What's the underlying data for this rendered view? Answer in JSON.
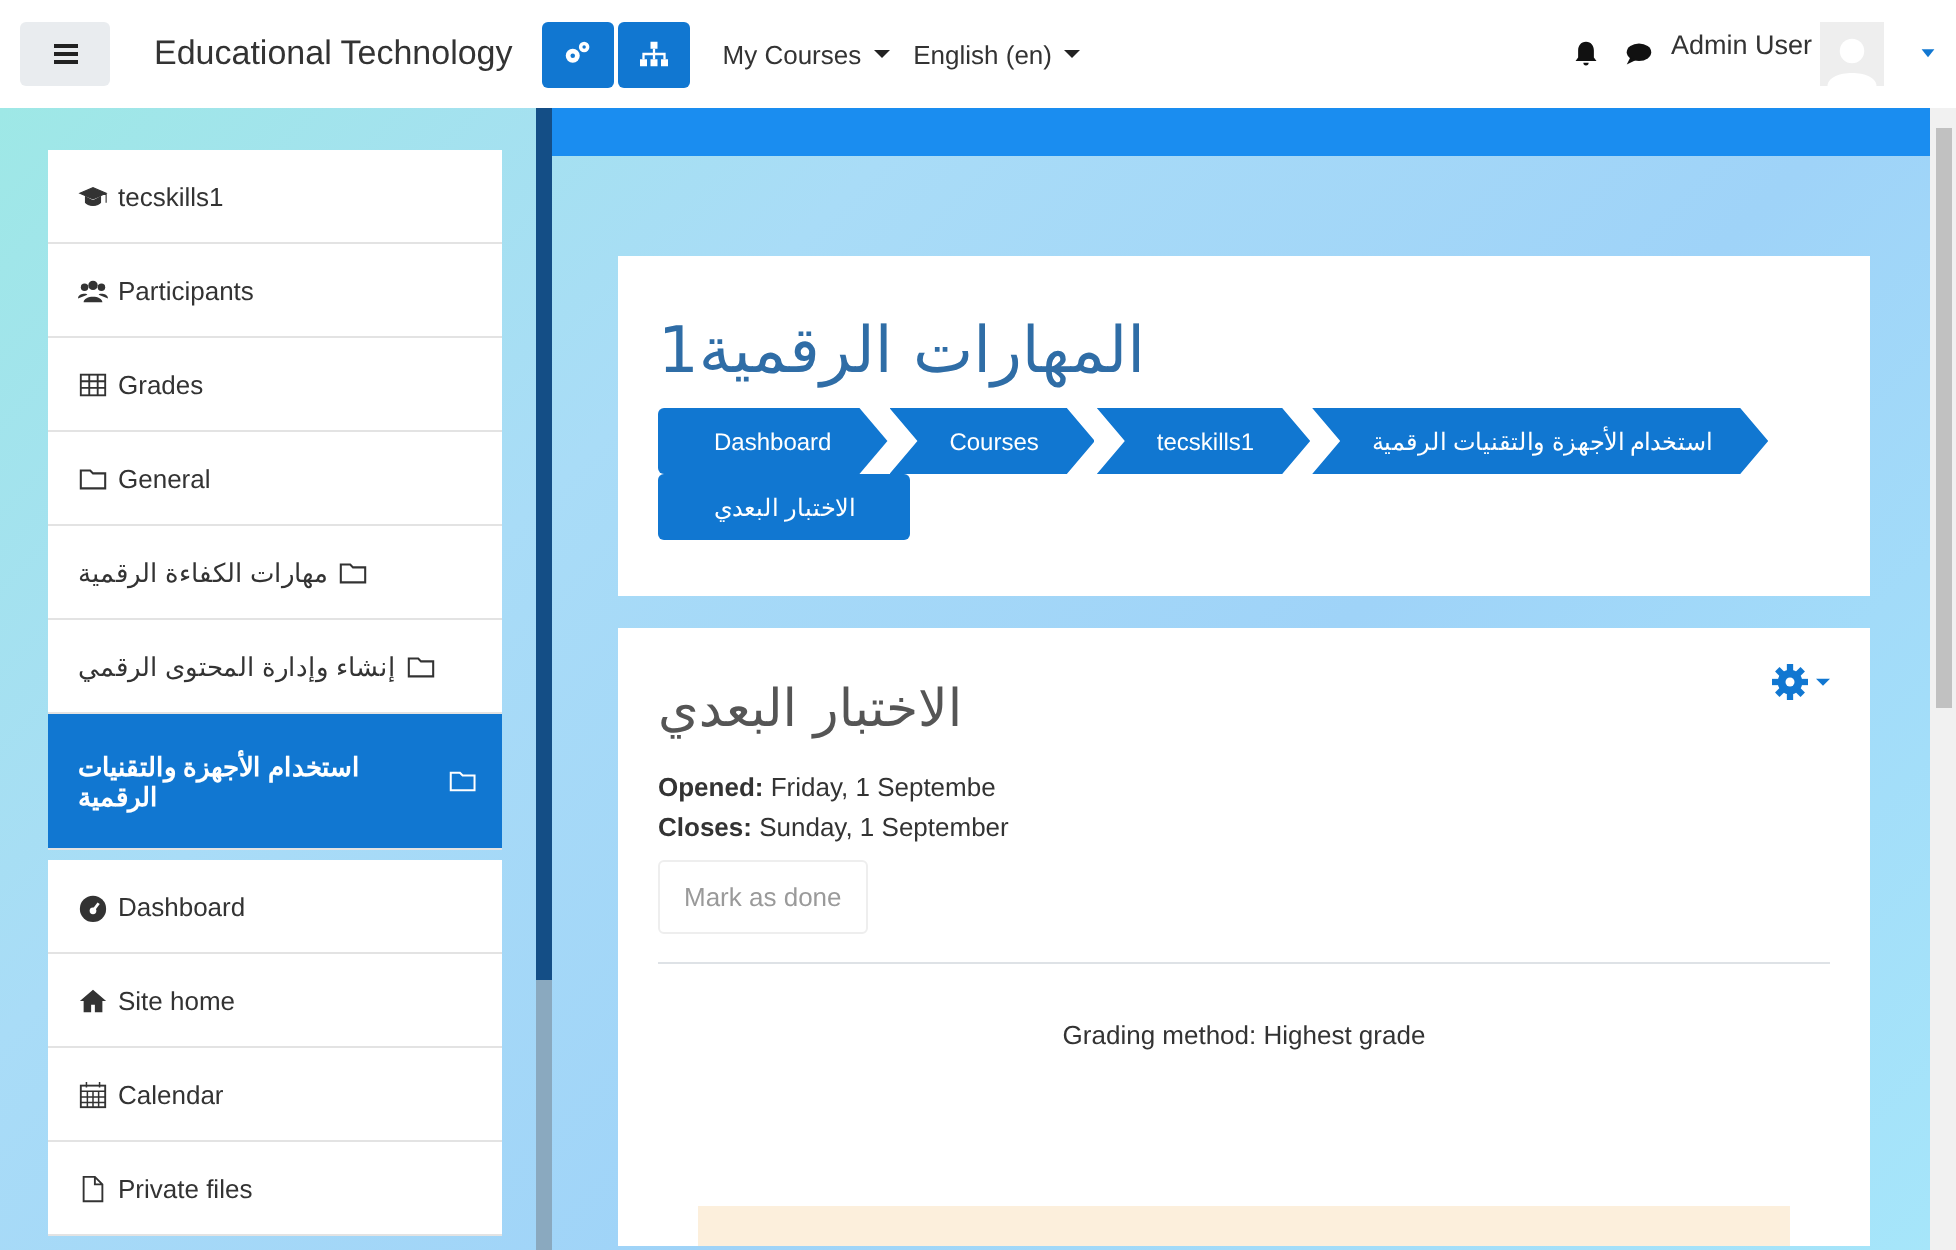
{
  "navbar": {
    "site_name": "Educational Technology",
    "menus": [
      {
        "label": "My Courses"
      },
      {
        "label": "English (en)"
      }
    ],
    "user": "Admin User"
  },
  "drawer": {
    "sections": [
      {
        "items": [
          {
            "label": "tecskills1",
            "kind": "course",
            "selected": false
          },
          {
            "label": "Participants",
            "kind": "participants",
            "selected": false
          },
          {
            "label": "Grades",
            "kind": "grades",
            "selected": false
          },
          {
            "label": "General",
            "kind": "folder",
            "selected": false
          },
          {
            "label": "مهارات الكفاءة الرقمية",
            "kind": "folder",
            "selected": false
          },
          {
            "label": "إنشاء وإدارة المحتوى الرقمي",
            "kind": "folder",
            "selected": false
          },
          {
            "label": "استخدام الأجهزة والتقنيات الرقمية",
            "kind": "folder",
            "selected": true
          }
        ]
      },
      {
        "items": [
          {
            "label": "Dashboard",
            "kind": "dashboard",
            "selected": false
          },
          {
            "label": "Site home",
            "kind": "home",
            "selected": false
          },
          {
            "label": "Calendar",
            "kind": "calendar",
            "selected": false
          },
          {
            "label": "Private files",
            "kind": "file",
            "selected": false
          }
        ]
      }
    ]
  },
  "page_header": {
    "title": "المهارات الرقمية1",
    "breadcrumb": [
      "Dashboard",
      "Courses",
      "tecskills1",
      "استخدام الأجهزة والتقنيات الرقمية",
      "الاختبار البعدي"
    ]
  },
  "activity": {
    "title": "الاختبار البعدي",
    "dates": [
      "**Opened:** Friday, 1 Septembe",
      "**Closes:** Sunday, 1 September"
    ],
    "completion_button": {
      "label": "Mark as done",
      "disabled": true
    },
    "grading_method": "Grading method: Highest grade"
  }
}
